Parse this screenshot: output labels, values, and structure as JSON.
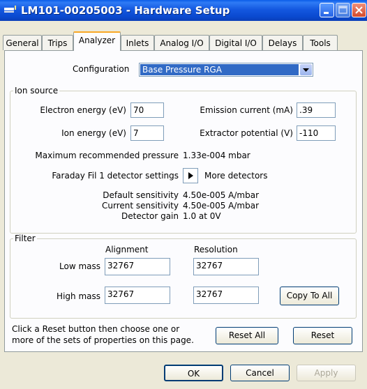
{
  "window": {
    "title": "LM101-00205003 - Hardware Setup"
  },
  "tabs": [
    {
      "label": "General"
    },
    {
      "label": "Trips"
    },
    {
      "label": "Analyzer"
    },
    {
      "label": "Inlets"
    },
    {
      "label": "Analog I/O"
    },
    {
      "label": "Digital I/O"
    },
    {
      "label": "Delays"
    },
    {
      "label": "Tools"
    }
  ],
  "active_tab": "Analyzer",
  "configuration": {
    "label": "Configuration",
    "value": "Base Pressure RGA"
  },
  "ion_source": {
    "legend": "Ion source",
    "electron_energy": {
      "label": "Electron energy (eV)",
      "value": "70"
    },
    "emission_current": {
      "label": "Emission current (mA)",
      "value": ".39"
    },
    "ion_energy": {
      "label": "Ion energy (eV)",
      "value": "7"
    },
    "extractor_potential": {
      "label": "Extractor potential (V)",
      "value": "-110"
    },
    "max_pressure": {
      "label": "Maximum recommended pressure",
      "value": "1.33e-004 mbar"
    },
    "detector_settings": {
      "label": "Faraday Fil 1 detector settings",
      "more_label": "More detectors"
    },
    "default_sensitivity": {
      "label": "Default sensitivity",
      "value": "4.50e-005 A/mbar"
    },
    "current_sensitivity": {
      "label": "Current sensitivity",
      "value": "4.50e-005 A/mbar"
    },
    "detector_gain": {
      "label": "Detector gain",
      "value": "1.0 at 0V"
    }
  },
  "filter": {
    "legend": "Filter",
    "alignment_header": "Alignment",
    "resolution_header": "Resolution",
    "low_mass": {
      "label": "Low mass",
      "alignment": "32767",
      "resolution": "32767"
    },
    "high_mass": {
      "label": "High mass",
      "alignment": "32767",
      "resolution": "32767"
    },
    "copy_to_all": "Copy To All"
  },
  "reset": {
    "hint_line1": "Click a Reset button then choose one or",
    "hint_line2": "more of the sets of properties on this page.",
    "reset_all": "Reset All",
    "reset": "Reset"
  },
  "footer": {
    "ok": "OK",
    "cancel": "Cancel",
    "apply": "Apply"
  },
  "colors": {
    "titlebar": "#0a49cf",
    "tab_highlight": "#f9a825",
    "selection": "#316ac5"
  }
}
